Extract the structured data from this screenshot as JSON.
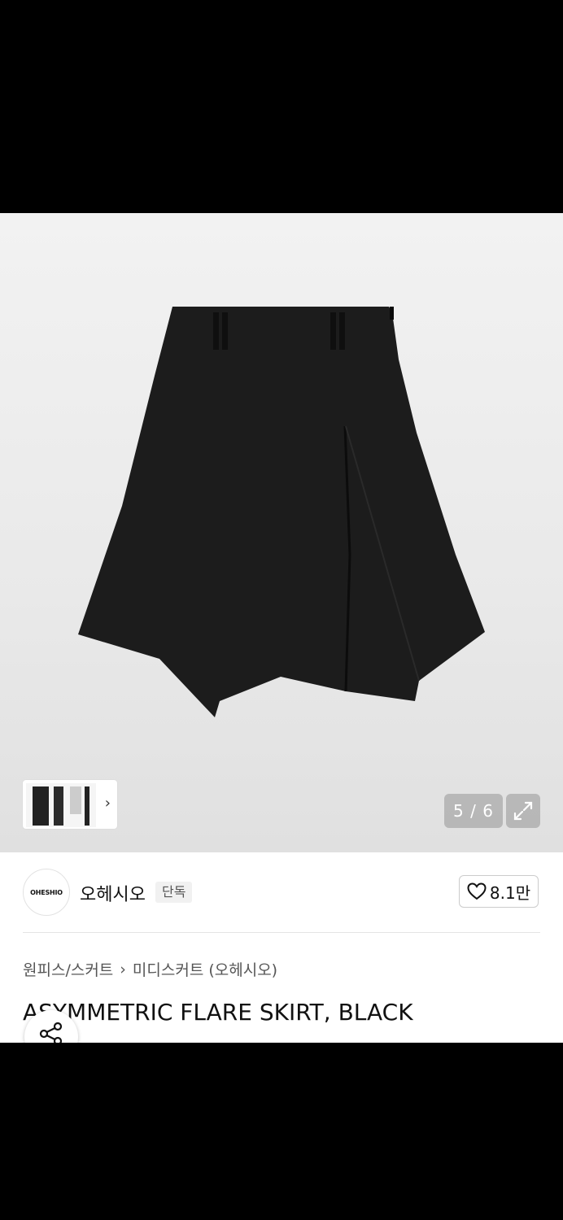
{
  "gallery": {
    "counter": "5 / 6",
    "thumb_chevron": "›",
    "icons": [
      "chevron-right-icon",
      "expand-icon"
    ]
  },
  "brand": {
    "logo_text": "OHESHIO",
    "name": "오헤시오",
    "badge": "단독",
    "likes": "8.1만",
    "like_icon": "heart-icon"
  },
  "breadcrumb": {
    "category": "원피스/스커트",
    "separator": "›",
    "subcategory": "미디스커트 (오헤시오)"
  },
  "product": {
    "title": "ASYMMETRIC FLARE SKIRT, BLACK",
    "share_icon": "share-icon"
  },
  "colors": {
    "hero_bg": "#efefef",
    "skirt": "#1c1c1c",
    "text": "#111111",
    "muted": "#555555"
  }
}
